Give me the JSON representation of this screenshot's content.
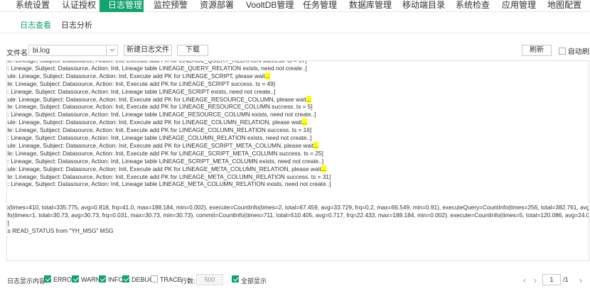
{
  "nav": {
    "tabs": [
      {
        "label": "系统设置"
      },
      {
        "label": "认证授权"
      },
      {
        "label": "日志管理"
      },
      {
        "label": "监控预警"
      },
      {
        "label": "资源部署"
      },
      {
        "label": "VooltDB管理"
      },
      {
        "label": "任务管理"
      },
      {
        "label": "数据库管理"
      },
      {
        "label": "移动端目录"
      },
      {
        "label": "系统检查"
      },
      {
        "label": "应用管理"
      },
      {
        "label": "地图配置"
      }
    ],
    "active_index": 2,
    "accent_color": "#13a36f"
  },
  "subtabs": [
    {
      "label": "日志查看"
    },
    {
      "label": "日志分析"
    }
  ],
  "toolbar": {
    "file_label": "文件名:",
    "file_value": "bi.log",
    "new_file_label": "新建日志文件",
    "download_label": "下载",
    "refresh_label": "刷新",
    "auto_refresh_label": "自动刷新"
  },
  "log": {
    "lines": [
      {
        "text": "ule: Lineage, Subject: Datasource, Action: Init, Execute add PK for LINEAGE_QUERY_RELATION success. ts = 57]",
        "hl": ""
      },
      {
        "text": "e: Lineage, Subject: Datasource, Action: Init, Lineage table LINEAGE_QUERY_RELATION exists, need not create..]",
        "hl": ""
      },
      {
        "text": "dule: Lineage, Subject: Datasource, Action: Init, Execute add PK for LINEAGE_SCRIPT, please wait",
        "hl": "..."
      },
      {
        "text": "ule: Lineage, Subject: Datasource, Action: Init, Execute add PK for LINEAGE_SCRIPT success. ts = 49]",
        "hl": ""
      },
      {
        "text": "e: Lineage, Subject: Datasource, Action: Init, Lineage table LINEAGE_SCRIPT exists, need not create..]",
        "hl": ""
      },
      {
        "text": "dule: Lineage, Subject: Datasource, Action: Init, Execute add PK for LINEAGE_RESOURCE_COLUMN, please wait",
        "hl": "..."
      },
      {
        "text": "ule: Lineage, Subject: Datasource, Action: Init, Execute add PK for LINEAGE_RESOURCE_COLUMN success. ts = 5]",
        "hl": ""
      },
      {
        "text": "e: Lineage, Subject: Datasource, Action: Init, Lineage table LINEAGE_RESOURCE_COLUMN exists, need not create..]",
        "hl": ""
      },
      {
        "text": "dule: Lineage, Subject: Datasource, Action: Init, Execute add PK for LINEAGE_COLUMN_RELATION, please wait",
        "hl": "..."
      },
      {
        "text": "ule: Lineage, Subject: Datasource, Action: Init, Execute add PK for LINEAGE_COLUMN_RELATION success. ts = 16]",
        "hl": ""
      },
      {
        "text": "e: Lineage, Subject: Datasource, Action: Init, Lineage table LINEAGE_COLUMN_RELATION exists, need not create..]",
        "hl": ""
      },
      {
        "text": "dule: Lineage, Subject: Datasource, Action: Init, Execute add PK for LINEAGE_SCRIPT_META_COLUMN, please wait",
        "hl": "..."
      },
      {
        "text": "ule: Lineage, Subject: Datasource, Action: Init, Execute add PK for LINEAGE_SCRIPT_META_COLUMN success. ts = 25]",
        "hl": ""
      },
      {
        "text": "e: Lineage, Subject: Datasource, Action: Init, Lineage table LINEAGE_SCRIPT_META_COLUMN exists, need not create..]",
        "hl": ""
      },
      {
        "text": "dule: Lineage, Subject: Datasource, Action: Init, Execute add PK for LINEAGE_META_COLUMN_RELATION, please wait",
        "hl": "..."
      },
      {
        "text": "ule: Lineage, Subject: Datasource, Action: Init, Execute add PK for LINEAGE_META_COLUMN_RELATION success. ts = 31]",
        "hl": ""
      },
      {
        "text": "e: Lineage, Subject: Datasource, Action: Init, Lineage table LINEAGE_META_COLUMN_RELATION exists, need not create..]",
        "hl": ""
      },
      {
        "text": "",
        "hl": ""
      },
      {
        "text": "",
        "hl": ""
      },
      {
        "text": "fo(times=410, total=335.775, avg=0.818, frq=41.0, max=188.184, min=0.002), execute=CountInfo(times=2, total=67.459, avg=33.729, frq=0.2, max=66.549, min=0.91), executeQuery=CountInfo(times=256, total=382.761, avg=1.4",
        "hl": ""
      },
      {
        "text": "nfo(times=1, total=30.73, avg=30.73, frq=0.031, max=30.73, min=30.73), commit=CountInfo(times=711, total=510.405, avg=0.717, frq=22.433, max=188.184, min=0.002), execute=CountInfo(times=5, total=120.086, avg=24.01",
        "hl": ""
      },
      {
        "text": "3]",
        "hl": ""
      },
      {
        "text": "as READ_STATUS  from  \"YH_MSG\" MSG",
        "hl": ""
      }
    ]
  },
  "footer": {
    "display_label": "日志显示内容:",
    "levels": [
      {
        "label": "ERROR",
        "checked": true
      },
      {
        "label": "WARN",
        "checked": true
      },
      {
        "label": "INFO",
        "checked": true
      },
      {
        "label": "DEBUG",
        "checked": true
      },
      {
        "label": "TRACE",
        "checked": false
      }
    ],
    "rows_label": "行数:",
    "rows_value": "500",
    "show_all_label": "全部显示",
    "show_all_checked": true,
    "page_current": "1",
    "page_total": "/1",
    "prev_glyph": "‹",
    "next_glyph": "›"
  }
}
